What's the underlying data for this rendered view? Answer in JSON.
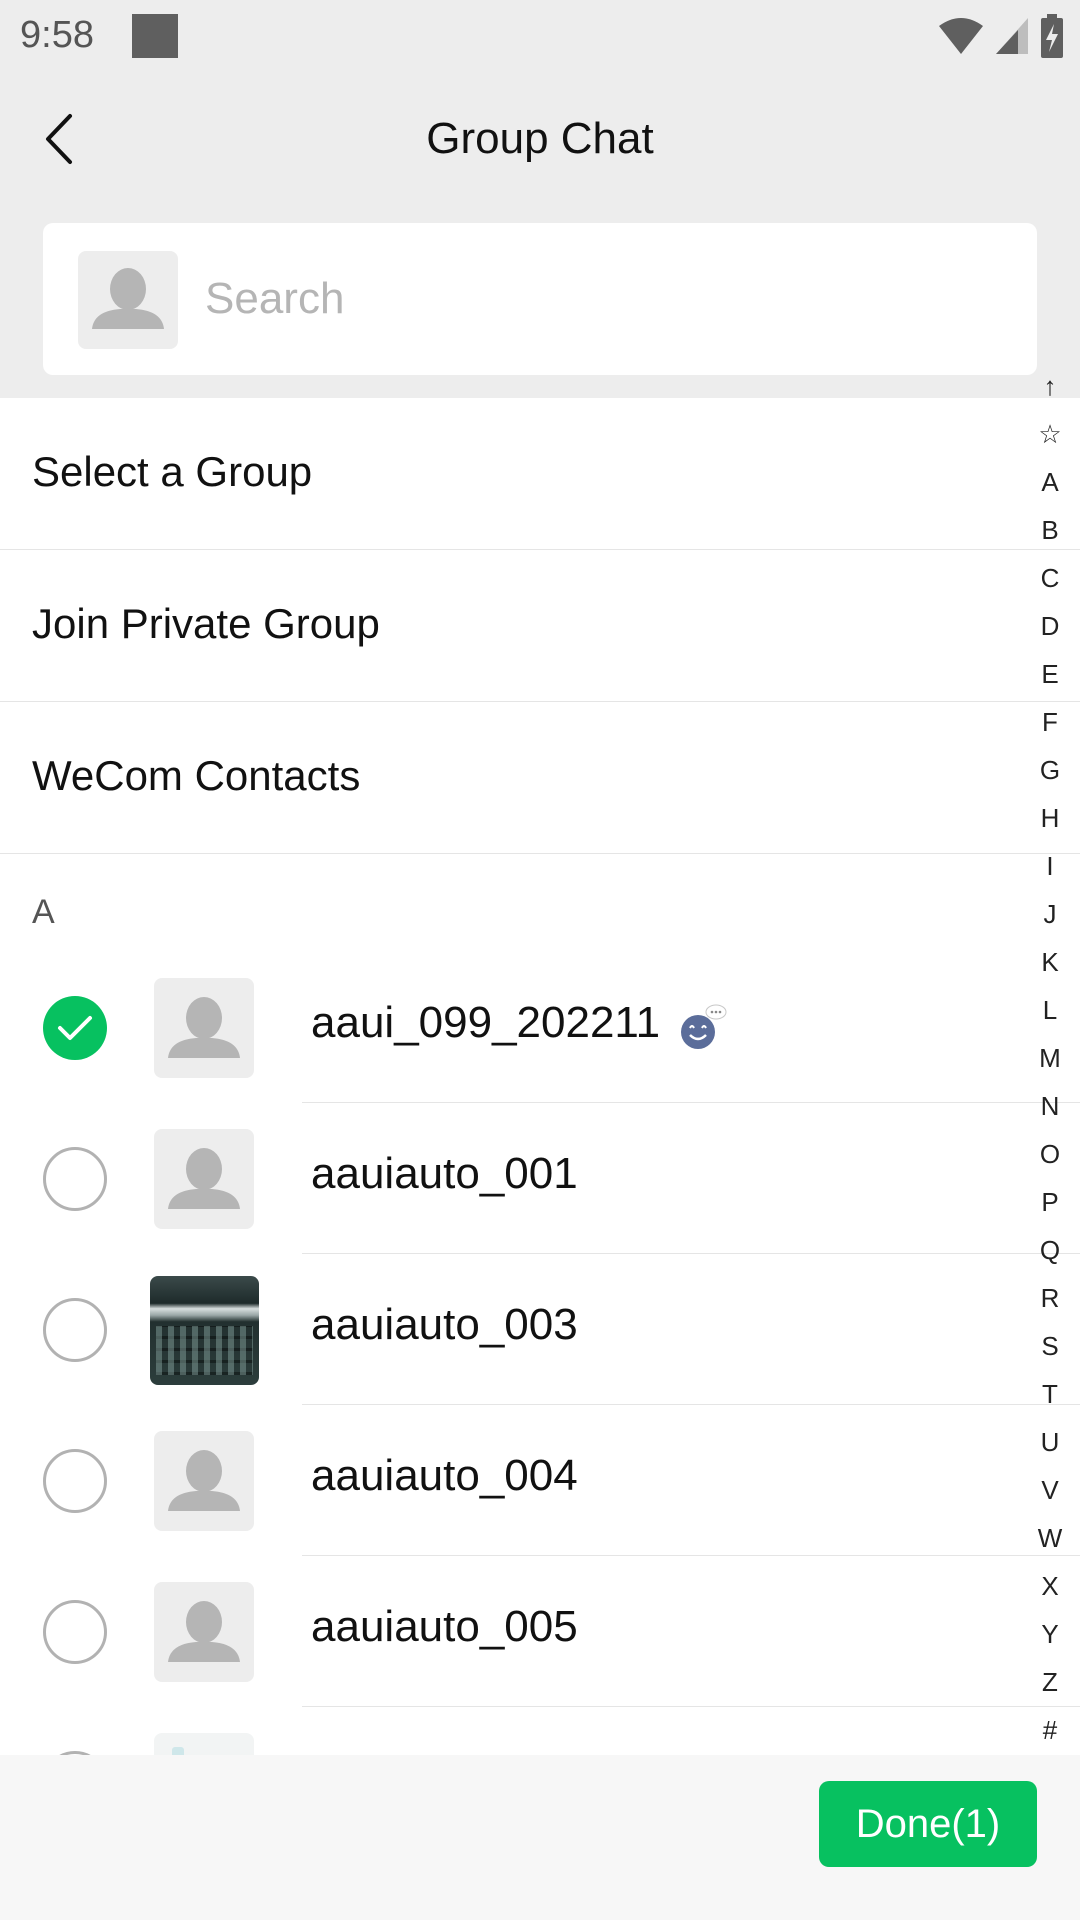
{
  "status_bar": {
    "time": "9:58",
    "icons": [
      "notification-square-icon",
      "wifi-icon",
      "signal-icon",
      "battery-charging-icon"
    ]
  },
  "header": {
    "title": "Group Chat",
    "back_icon": "chevron-left-icon"
  },
  "search": {
    "placeholder": "Search",
    "value": ""
  },
  "menu": [
    {
      "label": "Select a Group"
    },
    {
      "label": "Join Private Group"
    },
    {
      "label": "WeCom Contacts"
    }
  ],
  "section": {
    "letter": "A"
  },
  "contacts": [
    {
      "name": "aaui_099_202211",
      "checked": true,
      "avatar": "default-avatar-icon",
      "emoji": "smiling-chat-emoji-icon"
    },
    {
      "name": "aauiauto_001",
      "checked": false,
      "avatar": "default-avatar-icon"
    },
    {
      "name": "aauiauto_003",
      "checked": false,
      "avatar": "keyboard-photo"
    },
    {
      "name": "aauiauto_004",
      "checked": false,
      "avatar": "default-avatar-icon"
    },
    {
      "name": "aauiauto_005",
      "checked": false,
      "avatar": "default-avatar-icon"
    },
    {
      "name": "",
      "checked": false,
      "avatar": "partial-photo"
    }
  ],
  "index": [
    "↑",
    "☆",
    "A",
    "B",
    "C",
    "D",
    "E",
    "F",
    "G",
    "H",
    "I",
    "J",
    "K",
    "L",
    "M",
    "N",
    "O",
    "P",
    "Q",
    "R",
    "S",
    "T",
    "U",
    "V",
    "W",
    "X",
    "Y",
    "Z",
    "#"
  ],
  "footer": {
    "done_label": "Done(1)"
  },
  "colors": {
    "accent": "#07c160",
    "background": "#ededed",
    "checkbox_border": "#b2b2b2"
  }
}
